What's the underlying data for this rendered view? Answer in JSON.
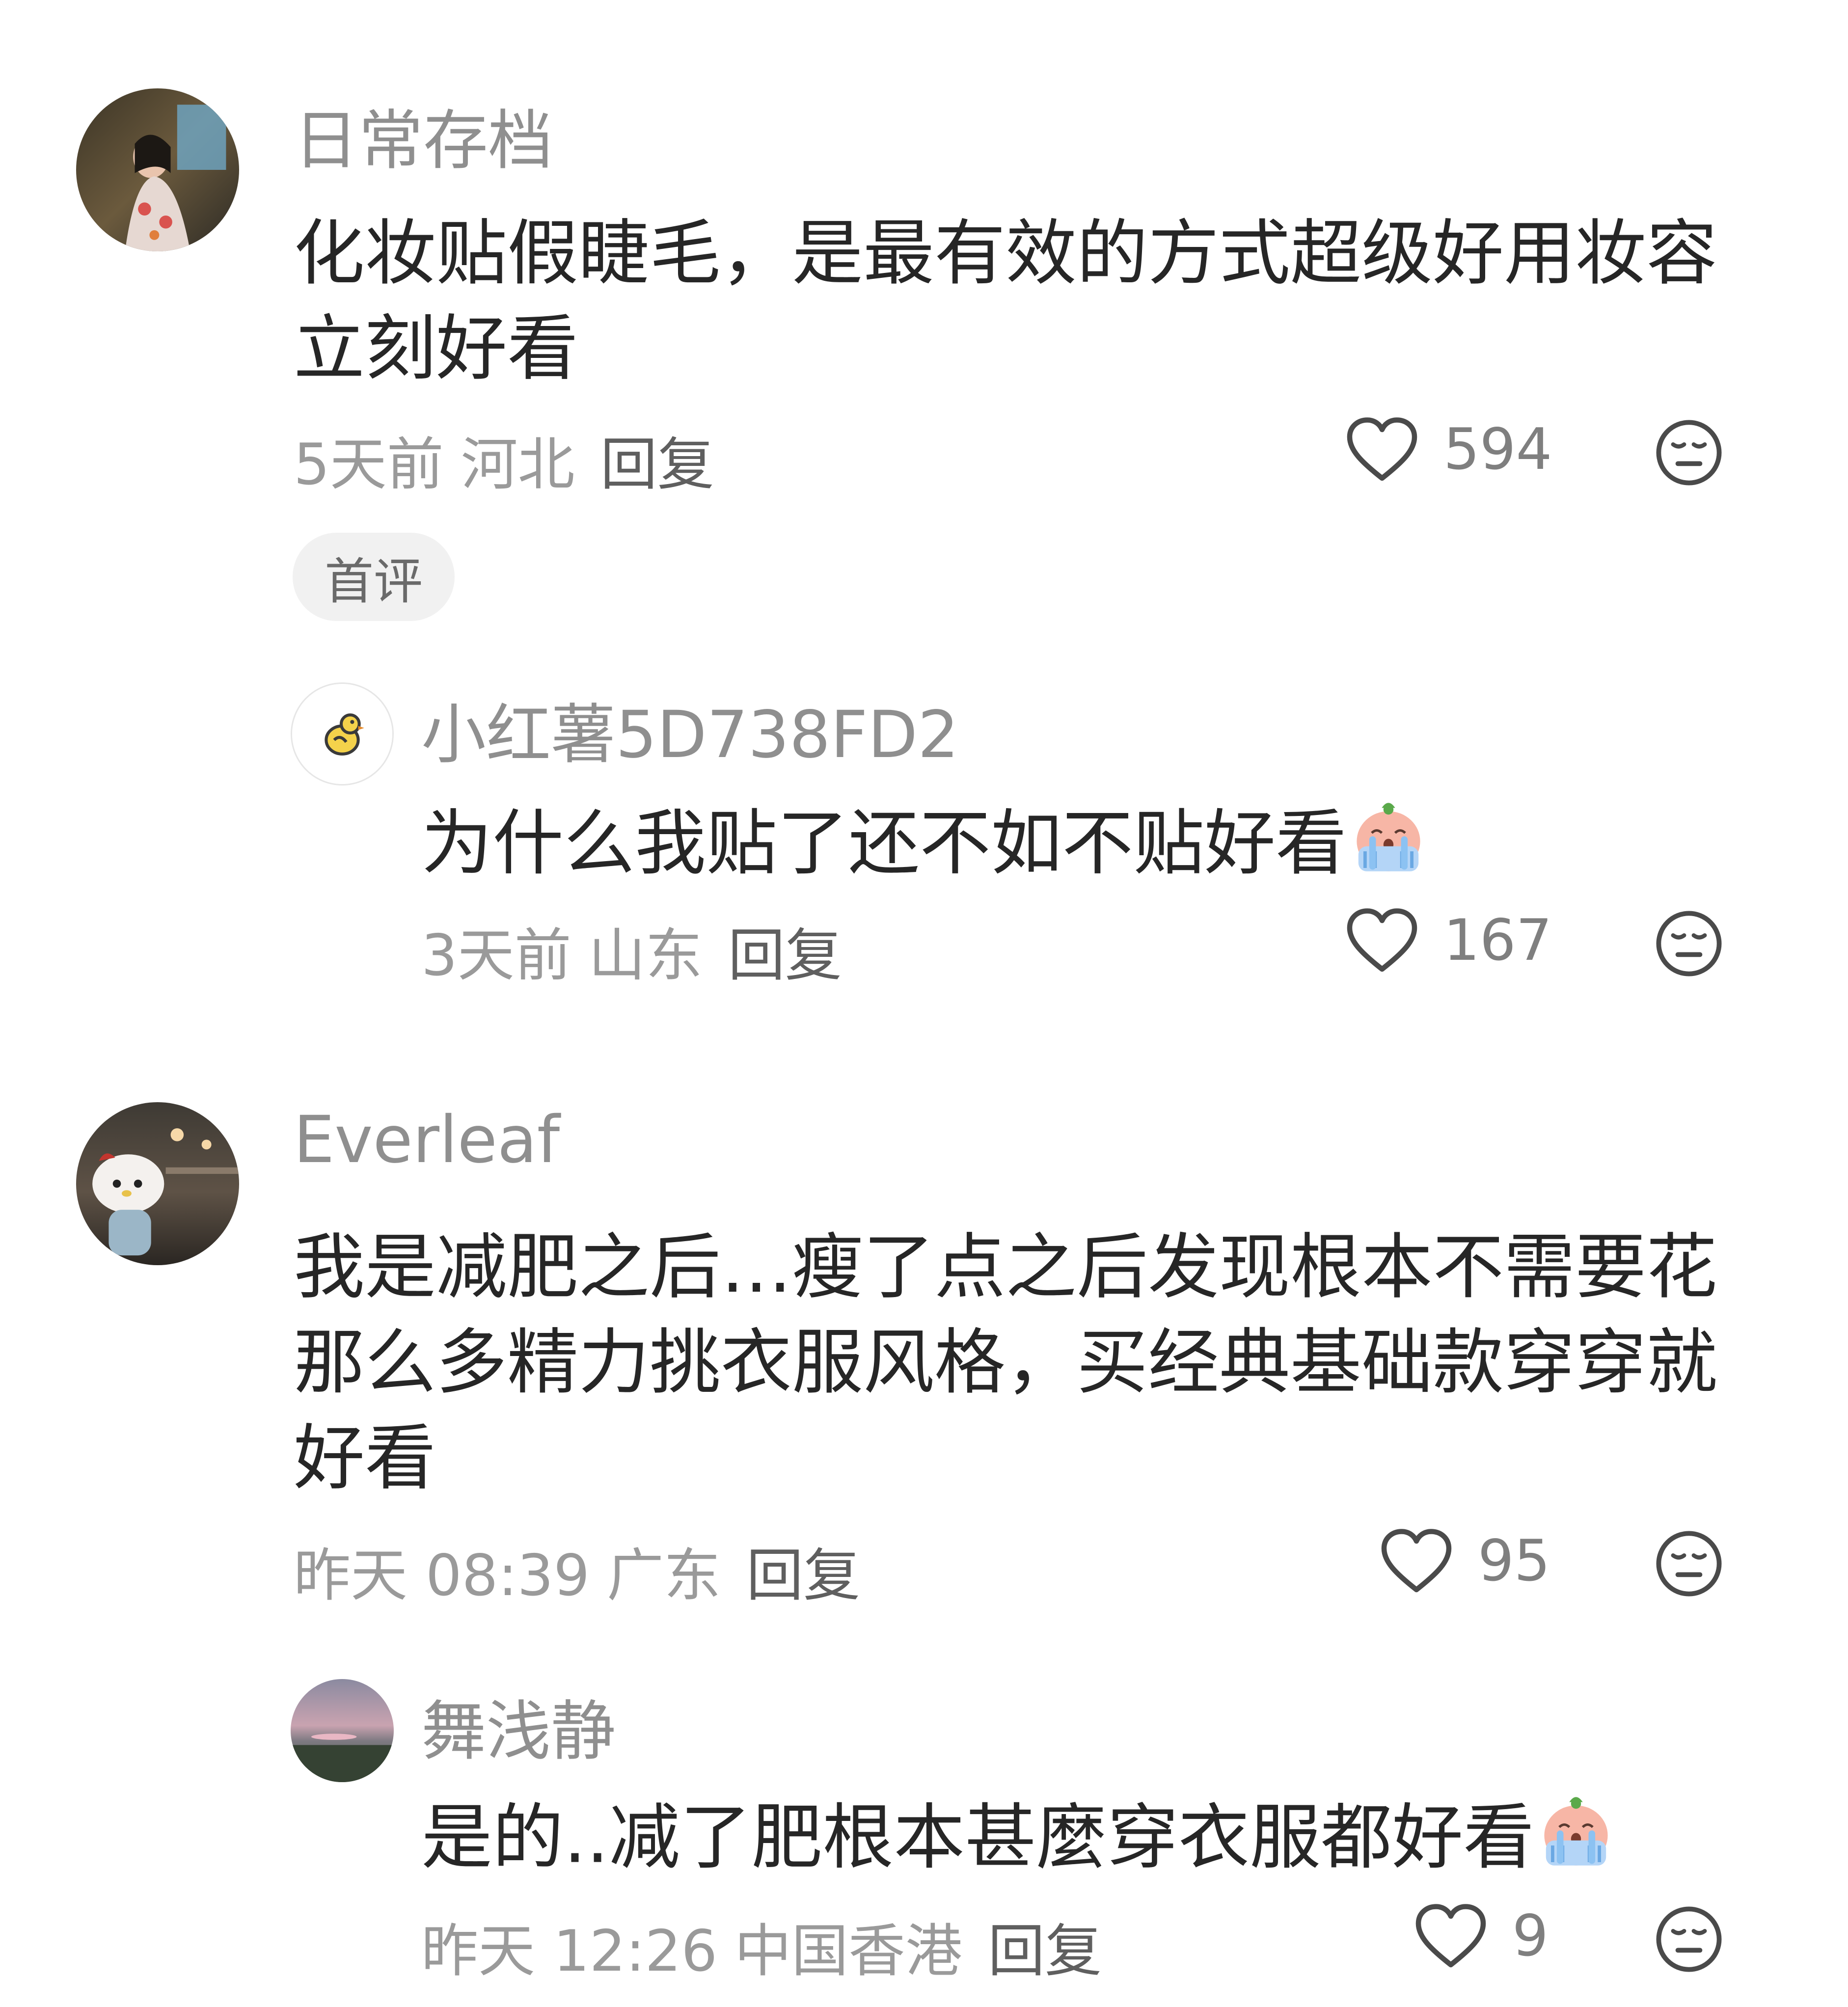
{
  "comments": [
    {
      "username": "日常存档",
      "text": "化妆贴假睫毛，是最有效的方式超级好用妆容立刻好看",
      "time": "5天前",
      "location": "河北",
      "reply_label": "回复",
      "likes": "594",
      "badge": "首评",
      "replies": [
        {
          "username": "小红薯5D738FD2",
          "text": "为什么我贴了还不如不贴好看",
          "emoji": "crying-emoji",
          "time": "3天前",
          "location": "山东",
          "reply_label": "回复",
          "likes": "167"
        }
      ]
    },
    {
      "username": "Everleaf",
      "text": "我是减肥之后…瘦了点之后发现根本不需要花那么多精力挑衣服风格，买经典基础款穿穿就好看",
      "time": "昨天 08:39",
      "location": "广东",
      "reply_label": "回复",
      "likes": "95",
      "replies": [
        {
          "username": "舞浅静",
          "text": "是的..减了肥根本甚麼穿衣服都好看",
          "emoji": "crying-emoji",
          "time": "昨天 12:26",
          "location": "中国香港",
          "reply_label": "回复",
          "likes": "9"
        }
      ]
    }
  ],
  "icons": {
    "like": "heart-outline-icon",
    "dislike": "unamused-face-icon"
  },
  "colors": {
    "username": "#8f8f8f",
    "text": "#262626",
    "meta": "#9a9a9a",
    "badge_bg": "#f1f1f1"
  }
}
